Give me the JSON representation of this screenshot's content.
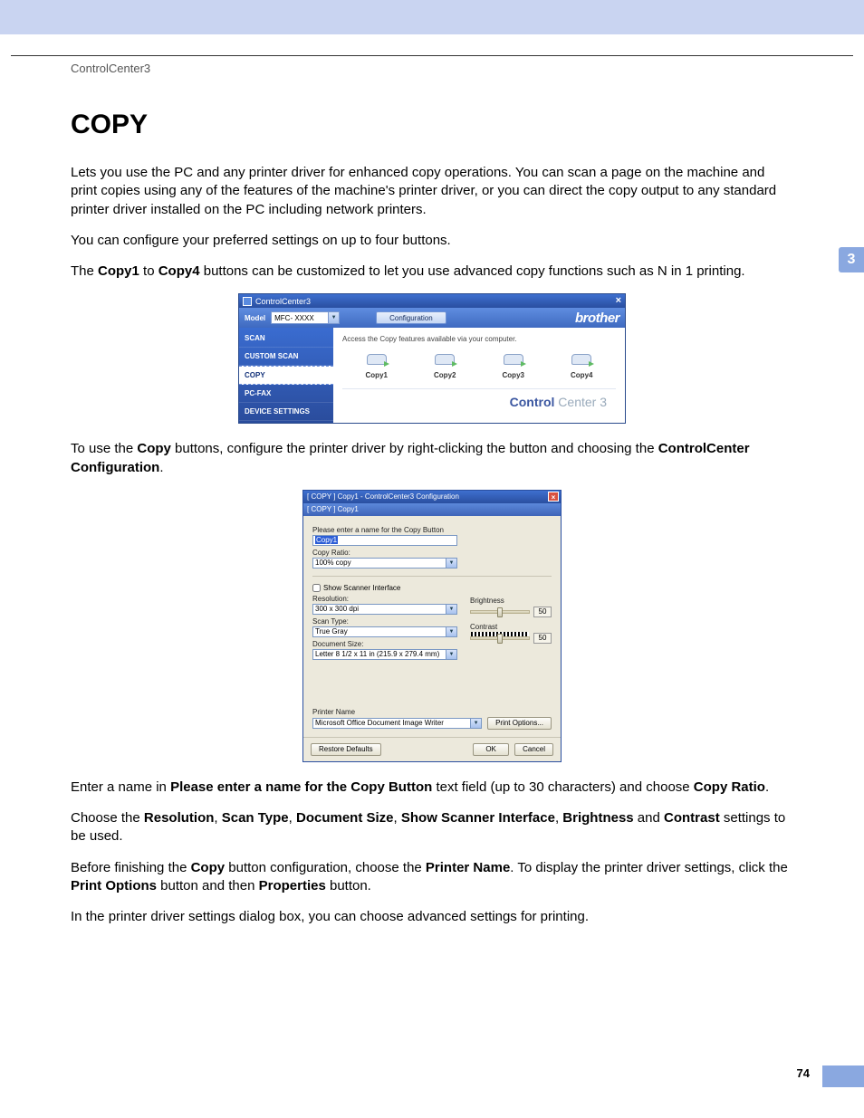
{
  "header": {
    "crumb": "ControlCenter3"
  },
  "title": "COPY",
  "side_tab": "3",
  "page_number": "74",
  "para1_a": "Lets you use the PC and any printer driver for enhanced copy operations. You can scan a page on the machine and print copies using any of the features of the machine's printer driver, or you can direct the copy output to any standard printer driver installed on the PC including network printers.",
  "para2": "You can configure your preferred settings on up to four buttons.",
  "para3_pre": "The ",
  "para3_b1": "Copy1",
  "para3_mid": " to ",
  "para3_b2": "Copy4",
  "para3_post": " buttons can be customized to let you use advanced copy functions such as N in 1 printing.",
  "para4_pre": "To use the ",
  "para4_b1": "Copy",
  "para4_mid": " buttons, configure the printer driver by right-clicking the button and choosing the ",
  "para4_b2": "ControlCenter Configuration",
  "para4_post": ".",
  "para5_pre": "Enter a name in ",
  "para5_b1": "Please enter a name for the Copy Button",
  "para5_mid": " text field (up to 30 characters) and choose ",
  "para5_b2": "Copy Ratio",
  "para5_post": ".",
  "para6_pre": "Choose the ",
  "para6_b1": "Resolution",
  "para6_c": ", ",
  "para6_b2": "Scan Type",
  "para6_b3": "Document Size",
  "para6_b4": "Show Scanner Interface",
  "para6_b5": "Brightness",
  "para6_and": " and ",
  "para6_b6": "Contrast",
  "para6_post": " settings to be used.",
  "para7_pre": "Before finishing the ",
  "para7_b1": "Copy",
  "para7_mid1": " button configuration, choose the ",
  "para7_b2": "Printer Name",
  "para7_mid2": ". To display the printer driver settings, click the ",
  "para7_b3": "Print Options",
  "para7_mid3": " button and then ",
  "para7_b4": "Properties",
  "para7_post": " button.",
  "para8": "In the printer driver settings dialog box, you can choose advanced settings for printing.",
  "cc": {
    "title": "ControlCenter3",
    "model_label": "Model",
    "model_value": "MFC- XXXX",
    "config_btn": "Configuration",
    "brand": "brother",
    "sidebar": [
      "SCAN",
      "CUSTOM SCAN",
      "COPY",
      "PC-FAX",
      "DEVICE SETTINGS"
    ],
    "hint": "Access the Copy features available via your computer.",
    "copy_btns": [
      "Copy1",
      "Copy2",
      "Copy3",
      "Copy4"
    ],
    "footer_b": "Control",
    "footer_l": " Center 3"
  },
  "cfg": {
    "title": "[  COPY  ]   Copy1 - ControlCenter3 Configuration",
    "tabs": "[  COPY  ]   Copy1",
    "name_label": "Please enter a name for the Copy Button",
    "name_value": "Copy1",
    "ratio_label": "Copy Ratio:",
    "ratio_value": "100% copy",
    "show_iface": "Show Scanner Interface",
    "res_label": "Resolution:",
    "res_value": "300 x 300 dpi",
    "type_label": "Scan Type:",
    "type_value": "True Gray",
    "size_label": "Document Size:",
    "size_value": "Letter 8 1/2 x 11 in (215.9 x 279.4 mm)",
    "bright_label": "Brightness",
    "bright_val": "50",
    "contrast_label": "Contrast",
    "contrast_val": "50",
    "prn_label": "Printer Name",
    "prn_value": "Microsoft Office Document Image Writer",
    "prn_opts": "Print Options...",
    "restore": "Restore Defaults",
    "ok": "OK",
    "cancel": "Cancel"
  }
}
